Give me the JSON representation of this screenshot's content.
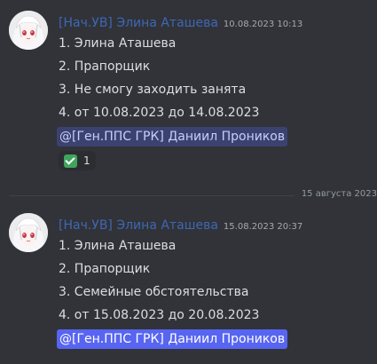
{
  "messages": [
    {
      "author": "[Нач.УВ] Элина Аташева",
      "timestamp": "10.08.2023 10:13",
      "lines": [
        "1. Элина Аташева",
        "2. Прапорщик",
        "3. Не смогу заходить занята",
        "4. от 10.08.2023 до 14.08.2023"
      ],
      "mention": "@[Ген.ППС ГРК] Даниил Проников",
      "reaction": {
        "emoji": "check-mark-icon",
        "count": "1"
      }
    },
    {
      "author": "[Нач.УВ] Элина Аташева",
      "timestamp": "15.08.2023 20:37",
      "lines": [
        "1. Элина Аташева",
        "2. Прапорщик",
        "3. Семейные обстоятельства",
        "4. от 15.08.2023 до 20.08.2023"
      ],
      "mention": "@[Ген.ППС ГРК] Даниил Проников"
    }
  ],
  "divider": {
    "label": "15 августа 2023"
  },
  "colors": {
    "background": "#313338",
    "author": "#3f67b5",
    "mention_bg_muted": "#3c4270",
    "mention_bg_active": "#5865f2",
    "reaction_check": "#3fa55c"
  }
}
